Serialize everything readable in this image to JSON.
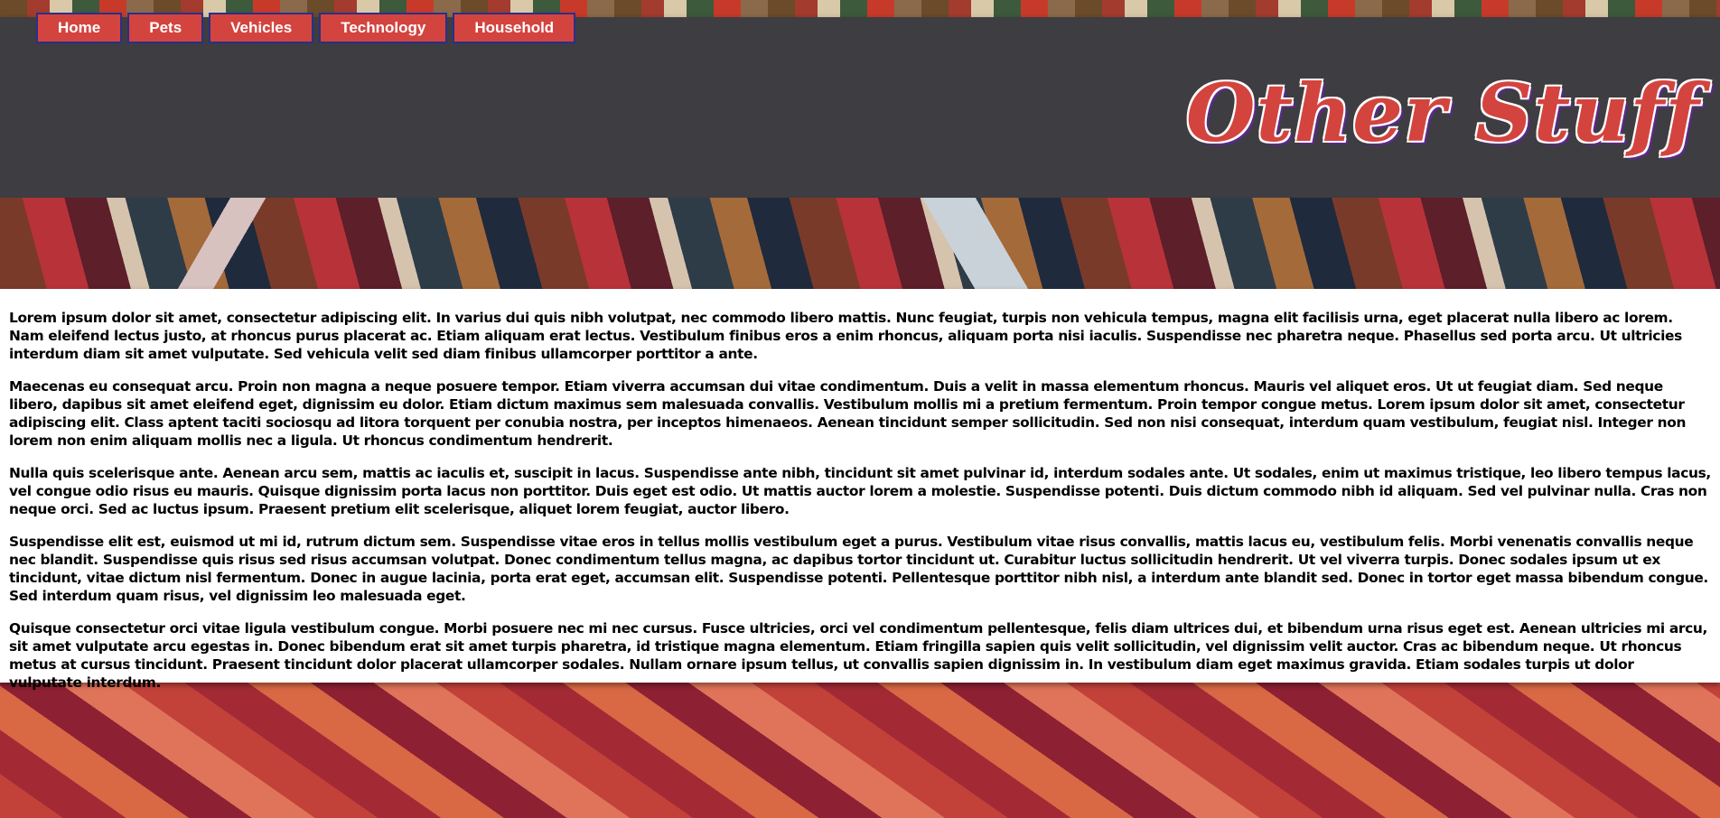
{
  "nav": {
    "items": [
      "Home",
      "Pets",
      "Vehicles",
      "Technology",
      "Household"
    ]
  },
  "header": {
    "title": "Other Stuff"
  },
  "colors": {
    "accent": "#d3443f",
    "header_bg": "#3d3d42",
    "nav_border": "#2a2f8a"
  },
  "content": {
    "paragraphs": [
      "Lorem ipsum dolor sit amet, consectetur adipiscing elit. In varius dui quis nibh volutpat, nec commodo libero mattis. Nunc feugiat, turpis non vehicula tempus, magna elit facilisis urna, eget placerat nulla libero ac lorem. Nam eleifend lectus justo, at rhoncus purus placerat ac. Etiam aliquam erat lectus. Vestibulum finibus eros a enim rhoncus, aliquam porta nisi iaculis. Suspendisse nec pharetra neque. Phasellus sed porta arcu. Ut ultricies interdum diam sit amet vulputate. Sed vehicula velit sed diam finibus ullamcorper porttitor a ante.",
      "Maecenas eu consequat arcu. Proin non magna a neque posuere tempor. Etiam viverra accumsan dui vitae condimentum. Duis a velit in massa elementum rhoncus. Mauris vel aliquet eros. Ut ut feugiat diam. Sed neque libero, dapibus sit amet eleifend eget, dignissim eu dolor. Etiam dictum maximus sem malesuada convallis. Vestibulum mollis mi a pretium fermentum. Proin tempor congue metus. Lorem ipsum dolor sit amet, consectetur adipiscing elit. Class aptent taciti sociosqu ad litora torquent per conubia nostra, per inceptos himenaeos. Aenean tincidunt semper sollicitudin. Sed non nisi consequat, interdum quam vestibulum, feugiat nisl. Integer non lorem non enim aliquam mollis nec a ligula. Ut rhoncus condimentum hendrerit.",
      "Nulla quis scelerisque ante. Aenean arcu sem, mattis ac iaculis et, suscipit in lacus. Suspendisse ante nibh, tincidunt sit amet pulvinar id, interdum sodales ante. Ut sodales, enim ut maximus tristique, leo libero tempus lacus, vel congue odio risus eu mauris. Quisque dignissim porta lacus non porttitor. Duis eget est odio. Ut mattis auctor lorem a molestie. Suspendisse potenti. Duis dictum commodo nibh id aliquam. Sed vel pulvinar nulla. Cras non neque orci. Sed ac luctus ipsum. Praesent pretium elit scelerisque, aliquet lorem feugiat, auctor libero.",
      "Suspendisse elit est, euismod ut mi id, rutrum dictum sem. Suspendisse vitae eros in tellus mollis vestibulum eget a purus. Vestibulum vitae risus convallis, mattis lacus eu, vestibulum felis. Morbi venenatis convallis neque nec blandit. Suspendisse quis risus sed risus accumsan volutpat. Donec condimentum tellus magna, ac dapibus tortor tincidunt ut. Curabitur luctus sollicitudin hendrerit. Ut vel viverra turpis. Donec sodales ipsum ut ex tincidunt, vitae dictum nisl fermentum. Donec in augue lacinia, porta erat eget, accumsan elit. Suspendisse potenti. Pellentesque porttitor nibh nisl, a interdum ante blandit sed. Donec in tortor eget massa bibendum congue. Sed interdum quam risus, vel dignissim leo malesuada eget.",
      "Quisque consectetur orci vitae ligula vestibulum congue. Morbi posuere nec mi nec cursus. Fusce ultricies, orci vel condimentum pellentesque, felis diam ultrices dui, et bibendum urna risus eget est. Aenean ultricies mi arcu, sit amet vulputate arcu egestas in. Donec bibendum erat sit amet turpis pharetra, id tristique magna elementum. Etiam fringilla sapien quis velit sollicitudin, vel dignissim velit auctor. Cras ac bibendum neque. Ut rhoncus metus at cursus tincidunt. Praesent tincidunt dolor placerat ullamcorper sodales. Nullam ornare ipsum tellus, ut convallis sapien dignissim in. In vestibulum diam eget maximus gravida. Etiam sodales turpis ut dolor vulputate interdum."
    ]
  }
}
